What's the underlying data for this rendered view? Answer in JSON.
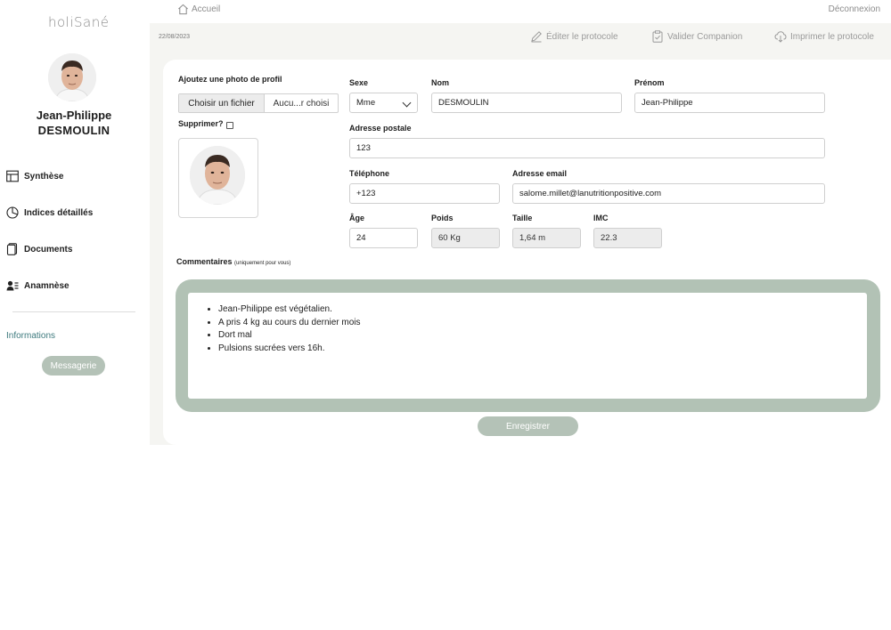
{
  "app": {
    "logo": "holiSané"
  },
  "user": {
    "first_name": "Jean-Philippe",
    "last_name": "DESMOULIN"
  },
  "sidebar": {
    "items": [
      {
        "label": "Synthèse",
        "icon": "layout-icon"
      },
      {
        "label": "Indices détaillés",
        "icon": "pie-chart-icon"
      },
      {
        "label": "Documents",
        "icon": "document-icon"
      },
      {
        "label": "Anamnèse",
        "icon": "user-list-icon"
      }
    ],
    "informations": "Informations",
    "messagerie": "Messagerie"
  },
  "header": {
    "breadcrumb": "Accueil",
    "logout": "Déconnexion",
    "date": "22/08/2023",
    "actions": {
      "edit": "Éditer le protocole",
      "validate": "Valider Companion",
      "print": "Imprimer le protocole"
    }
  },
  "form": {
    "photo_label": "Ajoutez une photo de profil",
    "file_button": "Choisir un fichier",
    "file_name": "Aucu...r choisi",
    "delete_label": "Supprimer?",
    "sexe": {
      "label": "Sexe",
      "value": "Mme"
    },
    "nom": {
      "label": "Nom",
      "value": "DESMOULIN"
    },
    "prenom": {
      "label": "Prénom",
      "value": "Jean-Philippe"
    },
    "adresse": {
      "label": "Adresse postale",
      "value": "123"
    },
    "telephone": {
      "label": "Téléphone",
      "value": "+123"
    },
    "email": {
      "label": "Adresse email",
      "value": "salome.millet@lanutritionpositive.com"
    },
    "age": {
      "label": "Âge",
      "value": "24"
    },
    "poids": {
      "label": "Poids",
      "value": "60 Kg"
    },
    "taille": {
      "label": "Taille",
      "value": "1,64 m"
    },
    "imc": {
      "label": "IMC",
      "value": "22.3"
    },
    "comments_label": "Commentaires",
    "comments_note": "(uniquement pour vous)",
    "comments": [
      "Jean-Philippe est végétalien.",
      "A pris 4 kg au cours du dernier mois",
      "Dort mal",
      "Pulsions sucrées vers 16h."
    ],
    "save": "Enregistrer"
  },
  "colors": {
    "accent": "#b4c2b7",
    "link": "#3e7a7e",
    "background": "#f5f5f2"
  }
}
